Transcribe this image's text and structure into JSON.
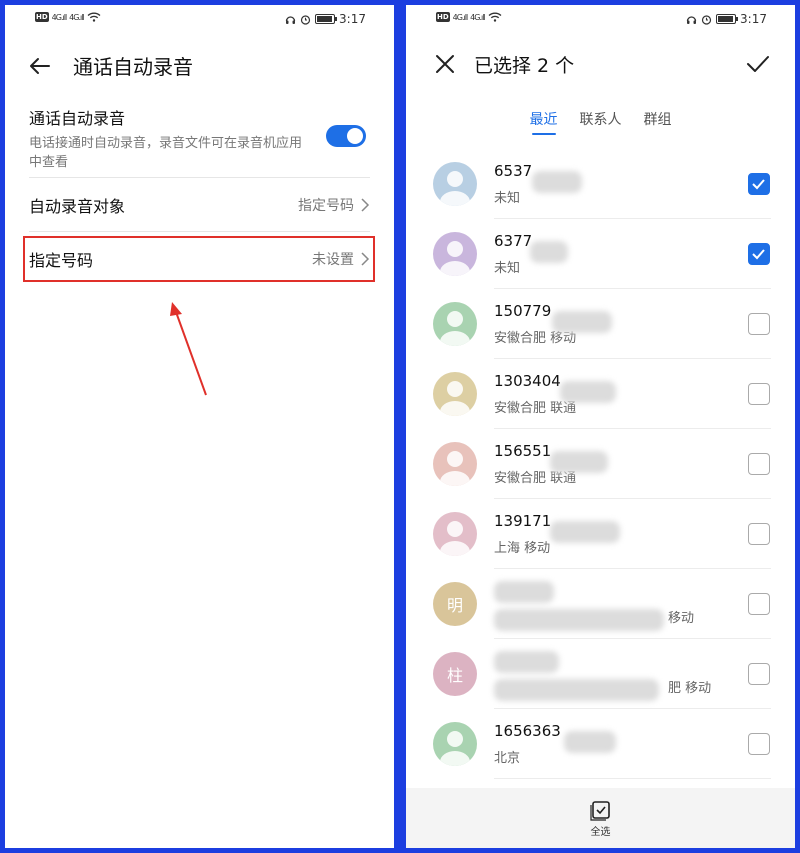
{
  "status_bar": {
    "hd": "HD",
    "signal_1": "4G.ıll",
    "signal_2": "4G.ıll",
    "time": "3:17"
  },
  "left_screen": {
    "title": "通话自动录音",
    "auto_record": {
      "label": "通话自动录音",
      "description": "电话接通时自动录音，录音文件可在录音机应用中查看",
      "enabled": true
    },
    "record_target": {
      "label": "自动录音对象",
      "value": "指定号码"
    },
    "specified_numbers": {
      "label": "指定号码",
      "value": "未设置"
    },
    "colors": {
      "accent": "#1e6fe6",
      "highlight": "#e0302a"
    }
  },
  "right_screen": {
    "title": "已选择 2 个",
    "tabs": [
      {
        "label": "最近",
        "active": true
      },
      {
        "label": "联系人",
        "active": false
      },
      {
        "label": "群组",
        "active": false
      }
    ],
    "contacts": [
      {
        "name": "6537",
        "sub": "未知",
        "checked": true,
        "avatar_color": "#b8cfe3",
        "avatar_text": ""
      },
      {
        "name": "6377",
        "sub": "未知",
        "checked": true,
        "avatar_color": "#c9b6dd",
        "avatar_text": ""
      },
      {
        "name": "150779",
        "sub": "安徽合肥 移动",
        "checked": false,
        "avatar_color": "#a9d3b1",
        "avatar_text": ""
      },
      {
        "name": "1303404",
        "sub": "安徽合肥 联通",
        "checked": false,
        "avatar_color": "#ddcfa3",
        "avatar_text": ""
      },
      {
        "name": "156551",
        "sub": "安徽合肥 联通",
        "checked": false,
        "avatar_color": "#e8c2bb",
        "avatar_text": ""
      },
      {
        "name": "139171",
        "sub": "上海 移动",
        "checked": false,
        "avatar_color": "#e3bec9",
        "avatar_text": ""
      },
      {
        "name": "",
        "sub": "移动",
        "checked": false,
        "avatar_color": "#d9c59a",
        "avatar_text": "明"
      },
      {
        "name": "",
        "sub": "肥 移动",
        "checked": false,
        "avatar_color": "#dcb3c2",
        "avatar_text": "柱"
      },
      {
        "name": "1656363",
        "sub": "北京",
        "checked": false,
        "avatar_color": "#a9d3b1",
        "avatar_text": ""
      }
    ],
    "select_all_label": "全选"
  }
}
